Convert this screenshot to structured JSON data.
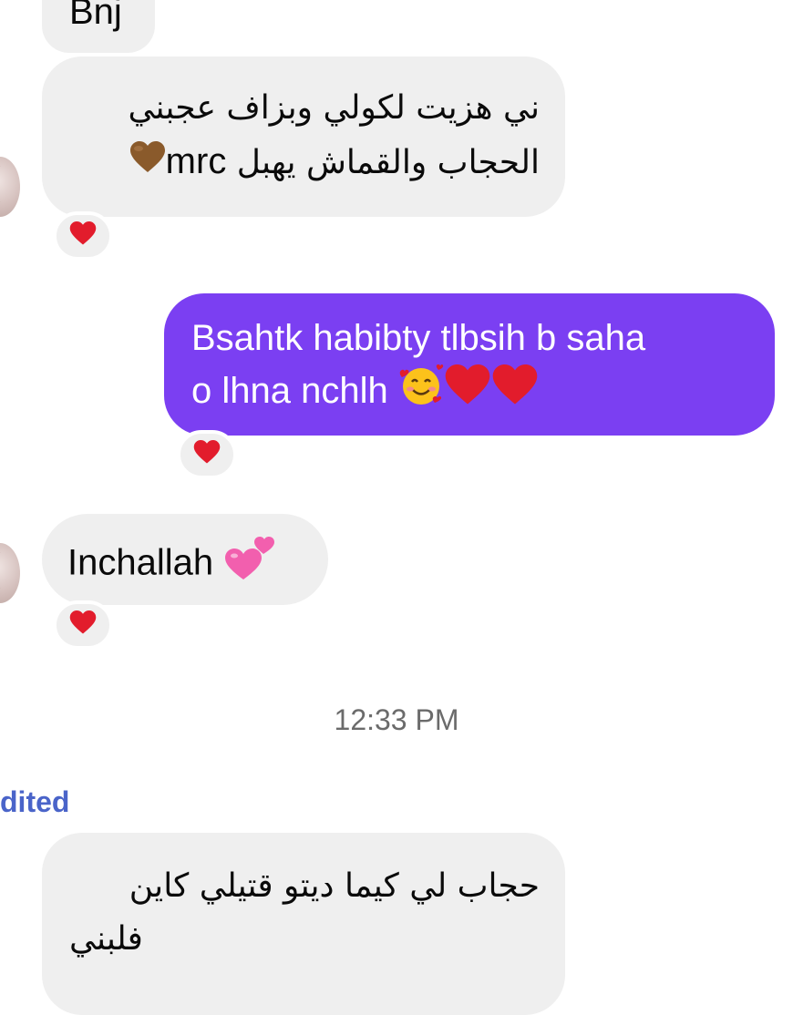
{
  "messages": {
    "m1": {
      "text": "Bnj"
    },
    "m2": {
      "line1": "ني هزيت لكولي وبزاف عجبني",
      "line2": "الحجاب والقماش يهبل",
      "line2_latin": "mrc"
    },
    "m3": {
      "line1": "Bsahtk habibty tlbsih b saha",
      "line2": "o lhna nchlh"
    },
    "m4": {
      "text": "Inchallah"
    },
    "m5": {
      "line1": "حجاب لي كيما ديتو قتيلي كاين",
      "line2": "فلبني"
    }
  },
  "timestamp": "12:33 PM",
  "edited_label": "dited",
  "colors": {
    "outgoing_bubble": "#7b3ff2",
    "incoming_bubble": "#efefef",
    "edited_link": "#4a64c9",
    "timestamp": "#6b6b6b"
  },
  "icons": [
    "red-heart-icon",
    "brown-heart-icon",
    "smiling-face-with-hearts-icon",
    "two-hearts-icon"
  ]
}
